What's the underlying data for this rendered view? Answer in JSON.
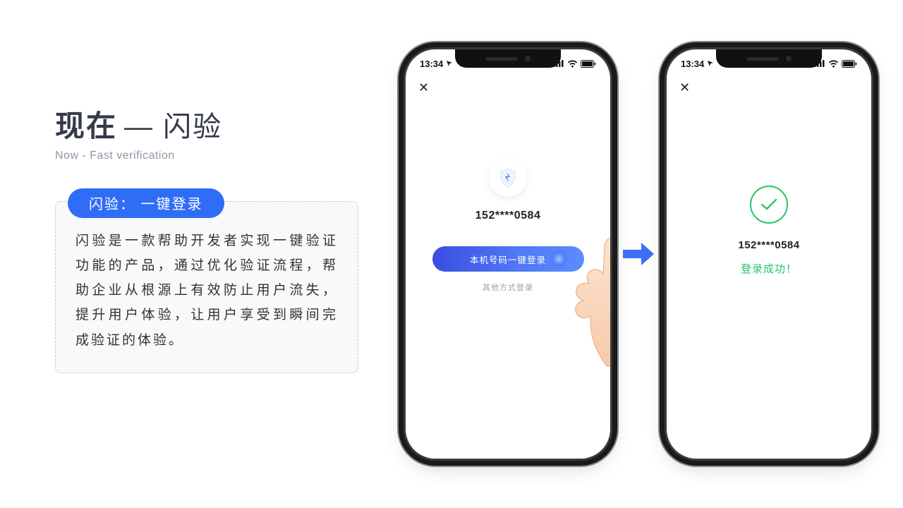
{
  "title": {
    "bold": "现在",
    "rest": " — 闪验"
  },
  "subtitle": "Now - Fast verification",
  "pill": "闪验： 一键登录",
  "description": "闪验是一款帮助开发者实现一键验证功能的产品，通过优化验证流程，帮助企业从根源上有效防止用户流失，提升用户体验，让用户享受到瞬间完成验证的体验。",
  "status_time": "13:34",
  "phoneA": {
    "phone_number": "152****0584",
    "login_button": "本机号码一键登录",
    "other_login": "其他方式登录"
  },
  "phoneB": {
    "phone_number": "152****0584",
    "success": "登录成功！"
  }
}
